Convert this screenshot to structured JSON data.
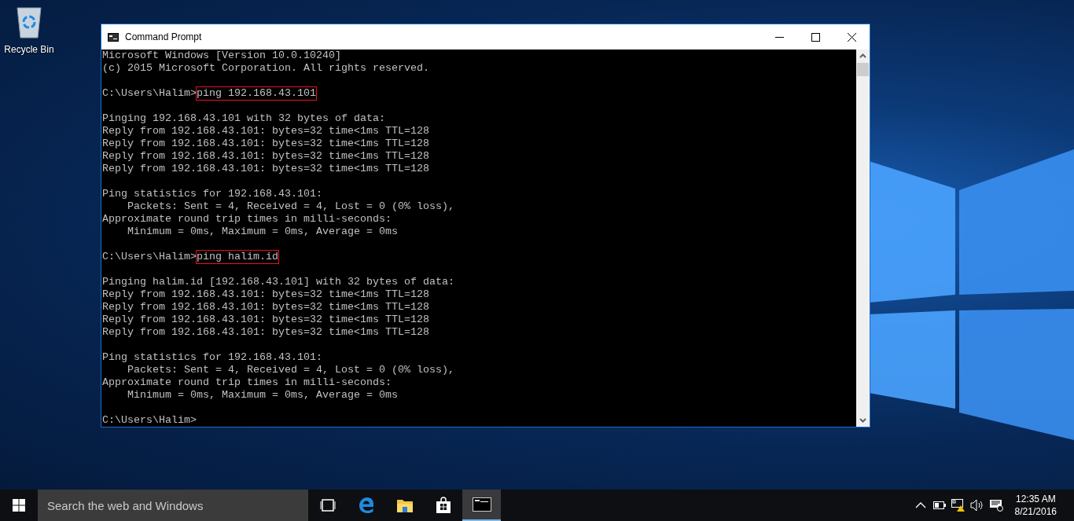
{
  "desktop": {
    "icons": [
      {
        "label": "Recycle Bin"
      }
    ]
  },
  "window": {
    "title": "Command Prompt"
  },
  "console": {
    "lines": [
      {
        "kind": "output",
        "text": "Microsoft Windows [Version 10.0.10240]"
      },
      {
        "kind": "output",
        "text": "(c) 2015 Microsoft Corporation. All rights reserved."
      },
      {
        "kind": "blank"
      },
      {
        "kind": "command",
        "prompt": "C:\\Users\\Halim>",
        "command": "ping 192.168.43.101",
        "highlighted": true
      },
      {
        "kind": "blank"
      },
      {
        "kind": "output",
        "text": "Pinging 192.168.43.101 with 32 bytes of data:"
      },
      {
        "kind": "output",
        "text": "Reply from 192.168.43.101: bytes=32 time<1ms TTL=128"
      },
      {
        "kind": "output",
        "text": "Reply from 192.168.43.101: bytes=32 time<1ms TTL=128"
      },
      {
        "kind": "output",
        "text": "Reply from 192.168.43.101: bytes=32 time<1ms TTL=128"
      },
      {
        "kind": "output",
        "text": "Reply from 192.168.43.101: bytes=32 time<1ms TTL=128"
      },
      {
        "kind": "blank"
      },
      {
        "kind": "output",
        "text": "Ping statistics for 192.168.43.101:"
      },
      {
        "kind": "output",
        "text": "    Packets: Sent = 4, Received = 4, Lost = 0 (0% loss),"
      },
      {
        "kind": "output",
        "text": "Approximate round trip times in milli-seconds:"
      },
      {
        "kind": "output",
        "text": "    Minimum = 0ms, Maximum = 0ms, Average = 0ms"
      },
      {
        "kind": "blank"
      },
      {
        "kind": "command",
        "prompt": "C:\\Users\\Halim>",
        "command": "ping halim.id",
        "highlighted": true
      },
      {
        "kind": "blank"
      },
      {
        "kind": "output",
        "text": "Pinging halim.id [192.168.43.101] with 32 bytes of data:"
      },
      {
        "kind": "output",
        "text": "Reply from 192.168.43.101: bytes=32 time<1ms TTL=128"
      },
      {
        "kind": "output",
        "text": "Reply from 192.168.43.101: bytes=32 time<1ms TTL=128"
      },
      {
        "kind": "output",
        "text": "Reply from 192.168.43.101: bytes=32 time<1ms TTL=128"
      },
      {
        "kind": "output",
        "text": "Reply from 192.168.43.101: bytes=32 time<1ms TTL=128"
      },
      {
        "kind": "blank"
      },
      {
        "kind": "output",
        "text": "Ping statistics for 192.168.43.101:"
      },
      {
        "kind": "output",
        "text": "    Packets: Sent = 4, Received = 4, Lost = 0 (0% loss),"
      },
      {
        "kind": "output",
        "text": "Approximate round trip times in milli-seconds:"
      },
      {
        "kind": "output",
        "text": "    Minimum = 0ms, Maximum = 0ms, Average = 0ms"
      },
      {
        "kind": "blank"
      },
      {
        "kind": "prompt",
        "prompt": "C:\\Users\\Halim>"
      }
    ]
  },
  "taskbar": {
    "search": {
      "placeholder": "Search the web and Windows"
    },
    "apps": [
      {
        "kind": "taskview",
        "selected": false
      },
      {
        "kind": "edge",
        "selected": false
      },
      {
        "kind": "explorer",
        "selected": false
      },
      {
        "kind": "store",
        "selected": false
      },
      {
        "kind": "cmd",
        "selected": true
      }
    ],
    "clock": {
      "time": "12:35 AM",
      "date": "8/21/2016"
    }
  }
}
